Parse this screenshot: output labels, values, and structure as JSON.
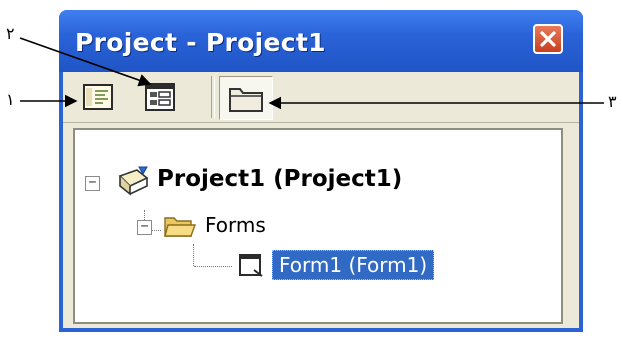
{
  "window": {
    "title": "Project - Project1"
  },
  "toolbar": {
    "buttons": [
      {
        "name": "View Code",
        "icon": "view-code-icon"
      },
      {
        "name": "View Object",
        "icon": "view-object-icon"
      },
      {
        "name": "Toggle Folders",
        "icon": "folder-icon"
      }
    ]
  },
  "tree": {
    "project": "Project1 (Project1)",
    "folder": "Forms",
    "form": "Form1 (Form1)"
  },
  "callouts": {
    "left": "١",
    "top": "٢",
    "right": "٣"
  },
  "colors": {
    "titlebar": "#2a63d8",
    "selection": "#316ac5",
    "window_bg": "#ece9d8"
  }
}
